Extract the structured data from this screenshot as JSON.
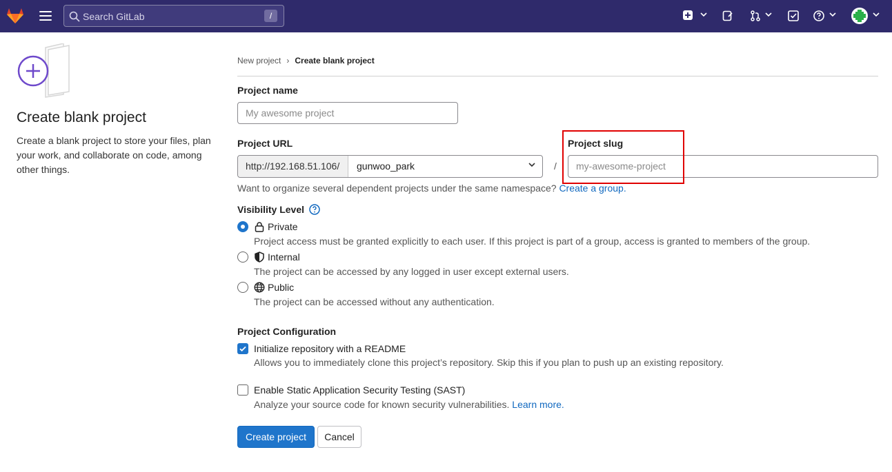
{
  "topbar": {
    "search_placeholder": "Search GitLab",
    "search_shortcut": "/"
  },
  "sidebar": {
    "title": "Create blank project",
    "description": "Create a blank project to store your files, plan your work, and collaborate on code, among other things."
  },
  "breadcrumb": {
    "items": [
      "New project",
      "Create blank project"
    ]
  },
  "form": {
    "project_name_label": "Project name",
    "project_name_placeholder": "My awesome project",
    "project_url_label": "Project URL",
    "url_prefix": "http://192.168.51.106/",
    "namespace_value": "gunwoo_park",
    "url_separator": "/",
    "project_slug_label": "Project slug",
    "project_slug_placeholder": "my-awesome-project",
    "namespace_help": "Want to organize several dependent projects under the same namespace?",
    "namespace_help_link": "Create a group.",
    "visibility_label": "Visibility Level",
    "visibility_options": [
      {
        "label": "Private",
        "icon": "lock-icon",
        "description": "Project access must be granted explicitly to each user. If this project is part of a group, access is granted to members of the group.",
        "selected": true
      },
      {
        "label": "Internal",
        "icon": "shield-icon",
        "description": "The project can be accessed by any logged in user except external users.",
        "selected": false
      },
      {
        "label": "Public",
        "icon": "globe-icon",
        "description": "The project can be accessed without any authentication.",
        "selected": false
      }
    ],
    "config_label": "Project Configuration",
    "readme_label": "Initialize repository with a README",
    "readme_desc": "Allows you to immediately clone this project’s repository. Skip this if you plan to push up an existing repository.",
    "readme_checked": true,
    "sast_label": "Enable Static Application Security Testing (SAST)",
    "sast_desc": "Analyze your source code for known security vulnerabilities.",
    "sast_link": "Learn more.",
    "sast_checked": false,
    "create_button": "Create project",
    "cancel_button": "Cancel"
  },
  "colors": {
    "header_bg": "#2f2a6b",
    "primary": "#1f75cb",
    "link": "#1068bf",
    "highlight_box": "#e00000"
  }
}
